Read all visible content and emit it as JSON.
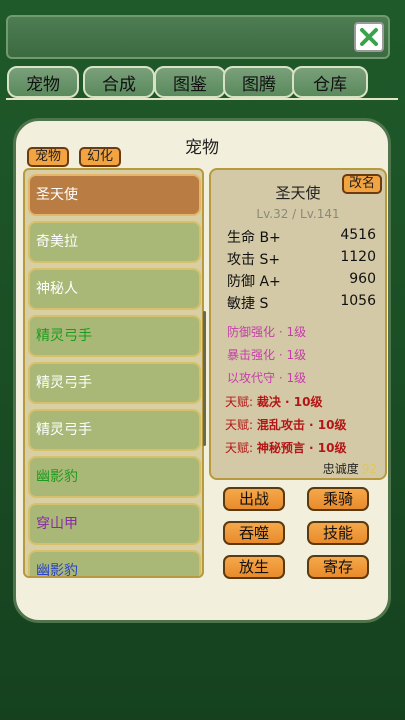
{
  "nav_tabs": [
    "宠物",
    "合成",
    "图鉴",
    "图腾",
    "仓库"
  ],
  "panel": {
    "title": "宠物",
    "chip_pet": "宠物",
    "chip_transform": "幻化"
  },
  "pet_list": [
    {
      "name": "圣天使",
      "color": "#ffffff"
    },
    {
      "name": "奇美拉",
      "color": "#ffffff"
    },
    {
      "name": "神秘人",
      "color": "#ffffff"
    },
    {
      "name": "精灵弓手",
      "color": "#1e9b1e"
    },
    {
      "name": "精灵弓手",
      "color": "#ffffff"
    },
    {
      "name": "精灵弓手",
      "color": "#ffffff"
    },
    {
      "name": "幽影豹",
      "color": "#1e9b1e"
    },
    {
      "name": "穿山甲",
      "color": "#8a2aa4"
    },
    {
      "name": "幽影豹",
      "color": "#2a44c8"
    }
  ],
  "details": {
    "rename_label": "改名",
    "name": "圣天使",
    "level": "Lv.32 / Lv.141",
    "stats": [
      {
        "label": "生命 B+",
        "value": "4516"
      },
      {
        "label": "攻击 S+",
        "value": "1120"
      },
      {
        "label": "防御 A+",
        "value": "960"
      },
      {
        "label": "敏捷 S",
        "value": "1056"
      }
    ],
    "skills": [
      "防御强化 · 1级",
      "暴击强化 · 1级",
      "以攻代守 · 1级"
    ],
    "talents": [
      {
        "prefix": "天赋:",
        "name": "裁决 · 10级"
      },
      {
        "prefix": "天赋:",
        "name": "混乱攻击 · 10级"
      },
      {
        "prefix": "天赋:",
        "name": "神秘预言 · 10级"
      }
    ],
    "loyalty_label": "忠诚度",
    "loyalty_value": "92"
  },
  "actions": [
    "出战",
    "乘骑",
    "吞噬",
    "技能",
    "放生",
    "寄存"
  ],
  "colors": {
    "accent_orange": "#f1a441",
    "selected_item": "#b97d44",
    "list_item": "#a9b877",
    "talent_red": "#b31616",
    "skill_pink": "#c33fa8"
  }
}
